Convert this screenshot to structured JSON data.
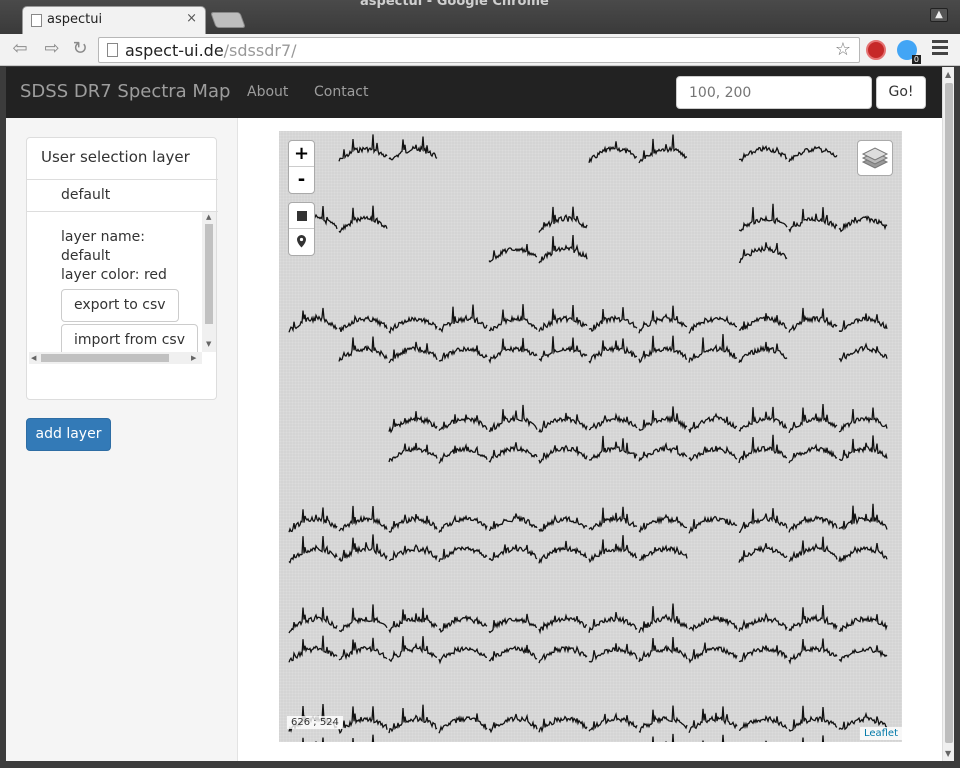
{
  "browser": {
    "window_title": "aspectui - Google Chrome",
    "tab_title": "aspectui",
    "tab_close": "×",
    "url_host": "aspect-ui.de",
    "url_path": "/sdssdr7/",
    "extension_badge": "0"
  },
  "navbar": {
    "brand": "SDSS DR7 Spectra Map",
    "links": [
      "About",
      "Contact"
    ],
    "coord_placeholder": "100, 200",
    "go_label": "Go!"
  },
  "sidebar": {
    "panel_title": "User selection layer",
    "layer_item": "default",
    "details": {
      "name_label": "layer name:",
      "name_value": "default",
      "color_line": "layer color: red",
      "export_label": "export to csv",
      "import_label": "import from csv"
    },
    "add_layer_label": "add layer"
  },
  "map": {
    "zoom_in": "+",
    "zoom_out": "-",
    "mouse_position": "626 ; 524",
    "attribution": "Leaflet",
    "icons": [
      "draw-rectangle-icon",
      "marker-icon",
      "layers-icon"
    ]
  },
  "colors": {
    "navbar_bg": "#222222",
    "primary": "#337ab7",
    "map_bg": "#d4d4d4"
  }
}
